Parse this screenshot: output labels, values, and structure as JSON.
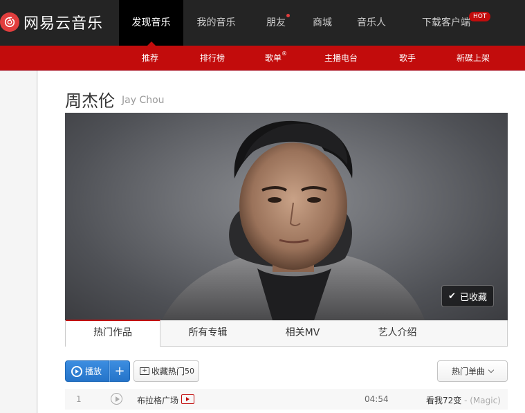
{
  "brand": {
    "name": "网易云音乐",
    "accent": "#c20c0c"
  },
  "nav": {
    "items": [
      {
        "label": "发现音乐",
        "active": true
      },
      {
        "label": "我的音乐"
      },
      {
        "label": "朋友",
        "dot": true
      },
      {
        "label": "商城"
      },
      {
        "label": "音乐人"
      },
      {
        "label": "下载客户端",
        "badge": "HOT"
      }
    ]
  },
  "subnav": {
    "items": [
      "推荐",
      "排行榜",
      "歌单",
      "主播电台",
      "歌手",
      "新碟上架"
    ],
    "registered_mark": "®"
  },
  "artist": {
    "name": "周杰伦",
    "name_en": "Jay Chou",
    "fav_label": "已收藏"
  },
  "tabs": [
    "热门作品",
    "所有专辑",
    "相关MV",
    "艺人介绍"
  ],
  "actions": {
    "play_label": "播放",
    "add_label": "+",
    "collect_label": "收藏热门",
    "collect_count": "50",
    "sort_label": "热门单曲"
  },
  "songs": [
    {
      "index": "1",
      "title": "布拉格广场",
      "duration": "04:54",
      "album": "看我72变",
      "album_alias": " - (Magic)"
    }
  ]
}
